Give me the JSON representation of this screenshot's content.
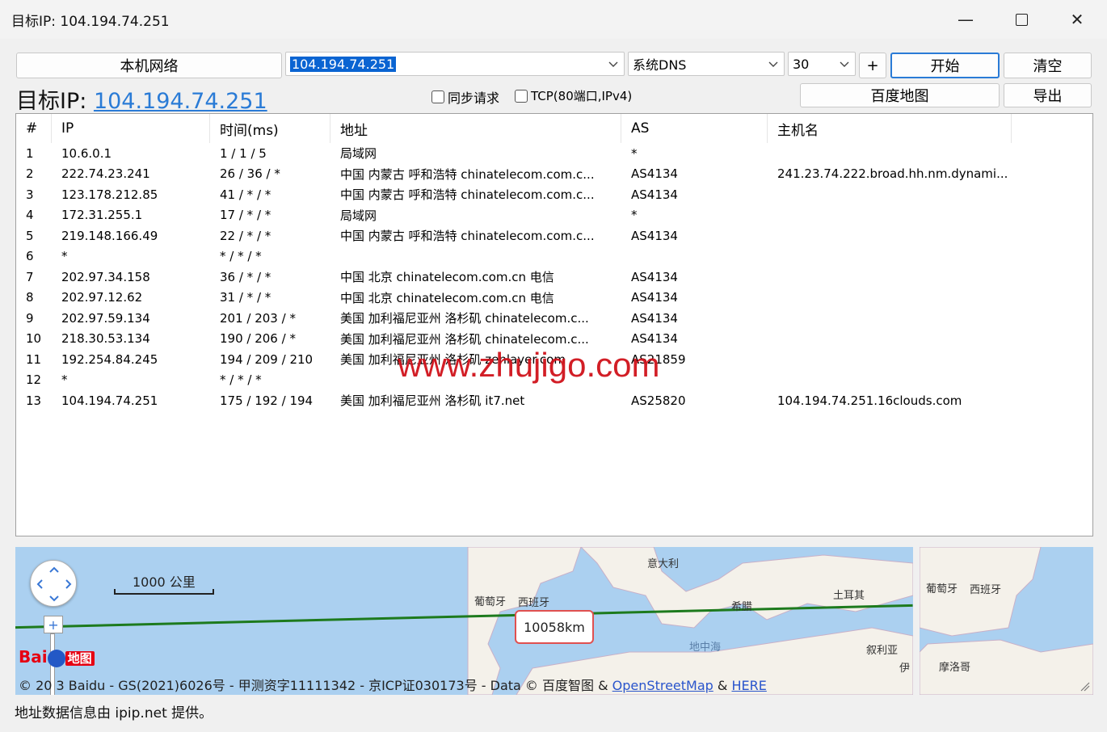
{
  "window": {
    "title": "目标IP: 104.194.74.251",
    "minimize": "—",
    "close": "✕"
  },
  "toolbar": {
    "local_network_label": "本机网络",
    "target_input_value": "104.194.74.251",
    "dns_value": "系统DNS",
    "count_value": "30",
    "plus_label": "+",
    "start_label": "开始",
    "clear_label": "清空",
    "baidu_map_label": "百度地图",
    "export_label": "导出",
    "sync_request_label": "同步请求",
    "tcp_label": "TCP(80端口,IPv4)"
  },
  "target": {
    "prefix": "目标IP:",
    "ip": "104.194.74.251"
  },
  "table": {
    "columns": [
      "#",
      "IP",
      "时间(ms)",
      "地址",
      "AS",
      "主机名"
    ],
    "rows": [
      [
        "1",
        "10.6.0.1",
        "1 / 1 / 5",
        "局域网",
        "*",
        ""
      ],
      [
        "2",
        "222.74.23.241",
        "26 / 36 / *",
        "中国 内蒙古 呼和浩特 chinatelecom.com.c...",
        "AS4134",
        "241.23.74.222.broad.hh.nm.dynami..."
      ],
      [
        "3",
        "123.178.212.85",
        "41 / * / *",
        "中国 内蒙古 呼和浩特 chinatelecom.com.c...",
        "AS4134",
        ""
      ],
      [
        "4",
        "172.31.255.1",
        "17 / * / *",
        "局域网",
        "*",
        ""
      ],
      [
        "5",
        "219.148.166.49",
        "22 / * / *",
        "中国 内蒙古 呼和浩特 chinatelecom.com.c...",
        "AS4134",
        ""
      ],
      [
        "6",
        "*",
        "* / * / *",
        "",
        "",
        ""
      ],
      [
        "7",
        "202.97.34.158",
        "36 / * / *",
        "中国 北京 chinatelecom.com.cn 电信",
        "AS4134",
        ""
      ],
      [
        "8",
        "202.97.12.62",
        "31 / * / *",
        "中国 北京 chinatelecom.com.cn 电信",
        "AS4134",
        ""
      ],
      [
        "9",
        "202.97.59.134",
        "201 / 203 / *",
        "美国 加利福尼亚州 洛杉矶 chinatelecom.c...",
        "AS4134",
        ""
      ],
      [
        "10",
        "218.30.53.134",
        "190 / 206 / *",
        "美国 加利福尼亚州 洛杉矶 chinatelecom.c...",
        "AS4134",
        ""
      ],
      [
        "11",
        "192.254.84.245",
        "194 / 209 / 210",
        "美国 加利福尼亚州 洛杉矶 zenlayer.com",
        "AS21859",
        ""
      ],
      [
        "12",
        "*",
        "* / * / *",
        "",
        "",
        ""
      ],
      [
        "13",
        "104.194.74.251",
        "175 / 192 / 194",
        "美国 加利福尼亚州 洛杉矶 it7.net",
        "AS25820",
        "104.194.74.251.16clouds.com"
      ]
    ]
  },
  "map": {
    "scale_label": "1000 公里",
    "distance": "10058km",
    "labels": {
      "italy": "意大利",
      "portugal": "葡萄牙",
      "spain": "西班牙",
      "greece": "希腊",
      "turkey": "土耳其",
      "mediterranean": "地中海",
      "syria": "叙利亚",
      "iran": "伊"
    },
    "baidu_brand": "Bai",
    "baidu_map": "地图",
    "copyright": "© 20 3 Baidu - GS(2021)6026号 - 甲测资字11111342 - 京ICP证030173号 - Data © 百度智图 &",
    "osm": "OpenStreetMap",
    "amp": "&",
    "here": "HERE",
    "zoom_in": "+",
    "mini_labels": {
      "portugal": "葡萄牙",
      "spain": "西班牙",
      "morocco": "摩洛哥"
    },
    "colors": {
      "sea": "#abd0f0",
      "land": "#f4f1ea",
      "route": "#1d7a1d"
    }
  },
  "status": "地址数据信息由 ipip.net 提供。",
  "watermark": "www.zhujigo.com"
}
